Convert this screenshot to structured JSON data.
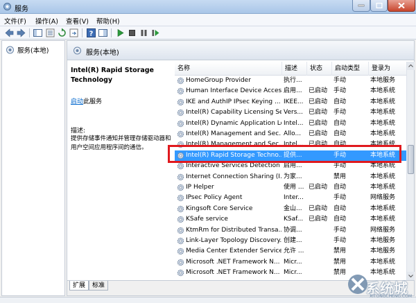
{
  "window": {
    "title": "服务"
  },
  "menu": [
    "文件(F)",
    "操作(A)",
    "查看(V)",
    "帮助(H)"
  ],
  "tree": {
    "root_label": "服务(本地)"
  },
  "pane_header": {
    "title": "服务(本地)"
  },
  "description": {
    "service_name": "Intel(R) Rapid Storage Technology",
    "link": "启动",
    "link_suffix": "此服务",
    "label": "描述:",
    "text": "提供存储事件通知并管理存储驱动器和用户空间应用程序间的通信。"
  },
  "columns": [
    "名称",
    "描述",
    "状态",
    "启动类型",
    "登录为"
  ],
  "services": [
    {
      "name": "HomeGroup Provider",
      "desc": "执行...",
      "status": "",
      "startup": "手动",
      "logon": "本地服务"
    },
    {
      "name": "Human Interface Device Access",
      "desc": "启用...",
      "status": "已启动",
      "startup": "手动",
      "logon": "本地系统"
    },
    {
      "name": "IKE and AuthIP IPsec Keying ...",
      "desc": "IKEE...",
      "status": "已启动",
      "startup": "自动",
      "logon": "本地系统"
    },
    {
      "name": "Intel(R) Capability Licensing Se...",
      "desc": "Vers...",
      "status": "已启动",
      "startup": "手动",
      "logon": "本地系统"
    },
    {
      "name": "Intel(R) Dynamic Application Lo...",
      "desc": "Intel...",
      "status": "已启动",
      "startup": "自动",
      "logon": "本地系统"
    },
    {
      "name": "Intel(R) Management and Sec...",
      "desc": "Allo...",
      "status": "已启动",
      "startup": "自动",
      "logon": "本地系统"
    },
    {
      "name": "Intel(R) Management and Sec...",
      "desc": "Intel...",
      "status": "已启动",
      "startup": "自动",
      "logon": "本地系统"
    },
    {
      "name": "Intel(R) Rapid Storage Techno...",
      "desc": "提供...",
      "status": "",
      "startup": "手动",
      "logon": "本地系统"
    },
    {
      "name": "Interactive Services Detection",
      "desc": "启用...",
      "status": "",
      "startup": "手动",
      "logon": "本地系统"
    },
    {
      "name": "Internet Connection Sharing (I...",
      "desc": "为家...",
      "status": "",
      "startup": "禁用",
      "logon": "本地系统"
    },
    {
      "name": "IP Helper",
      "desc": "使用 ...",
      "status": "已启动",
      "startup": "自动",
      "logon": "本地系统"
    },
    {
      "name": "IPsec Policy Agent",
      "desc": "Inter...",
      "status": "",
      "startup": "手动",
      "logon": "网络服务"
    },
    {
      "name": "Kingsoft Core Service",
      "desc": "金山...",
      "status": "已启动",
      "startup": "自动",
      "logon": "本地系统"
    },
    {
      "name": "KSafe service",
      "desc": "KSaf...",
      "status": "已启动",
      "startup": "自动",
      "logon": "本地系统"
    },
    {
      "name": "KtmRm for Distributed Transa...",
      "desc": "协调...",
      "status": "",
      "startup": "手动",
      "logon": "网络服务"
    },
    {
      "name": "Link-Layer Topology Discovery...",
      "desc": "创建...",
      "status": "",
      "startup": "手动",
      "logon": "本地服务"
    },
    {
      "name": "Media Center Extender Service",
      "desc": "允许 ...",
      "status": "",
      "startup": "禁用",
      "logon": "本地服务"
    },
    {
      "name": "Microsoft .NET Framework N...",
      "desc": "Micr...",
      "status": "",
      "startup": "禁用",
      "logon": "本地系统"
    },
    {
      "name": "Microsoft .NET Framework N...",
      "desc": "Micr...",
      "status": "",
      "startup": "禁用",
      "logon": "本地系统"
    }
  ],
  "tabs": [
    "扩展",
    "标准"
  ],
  "watermark": {
    "text": "系统城",
    "url": "XITONGCHENG.COM"
  }
}
